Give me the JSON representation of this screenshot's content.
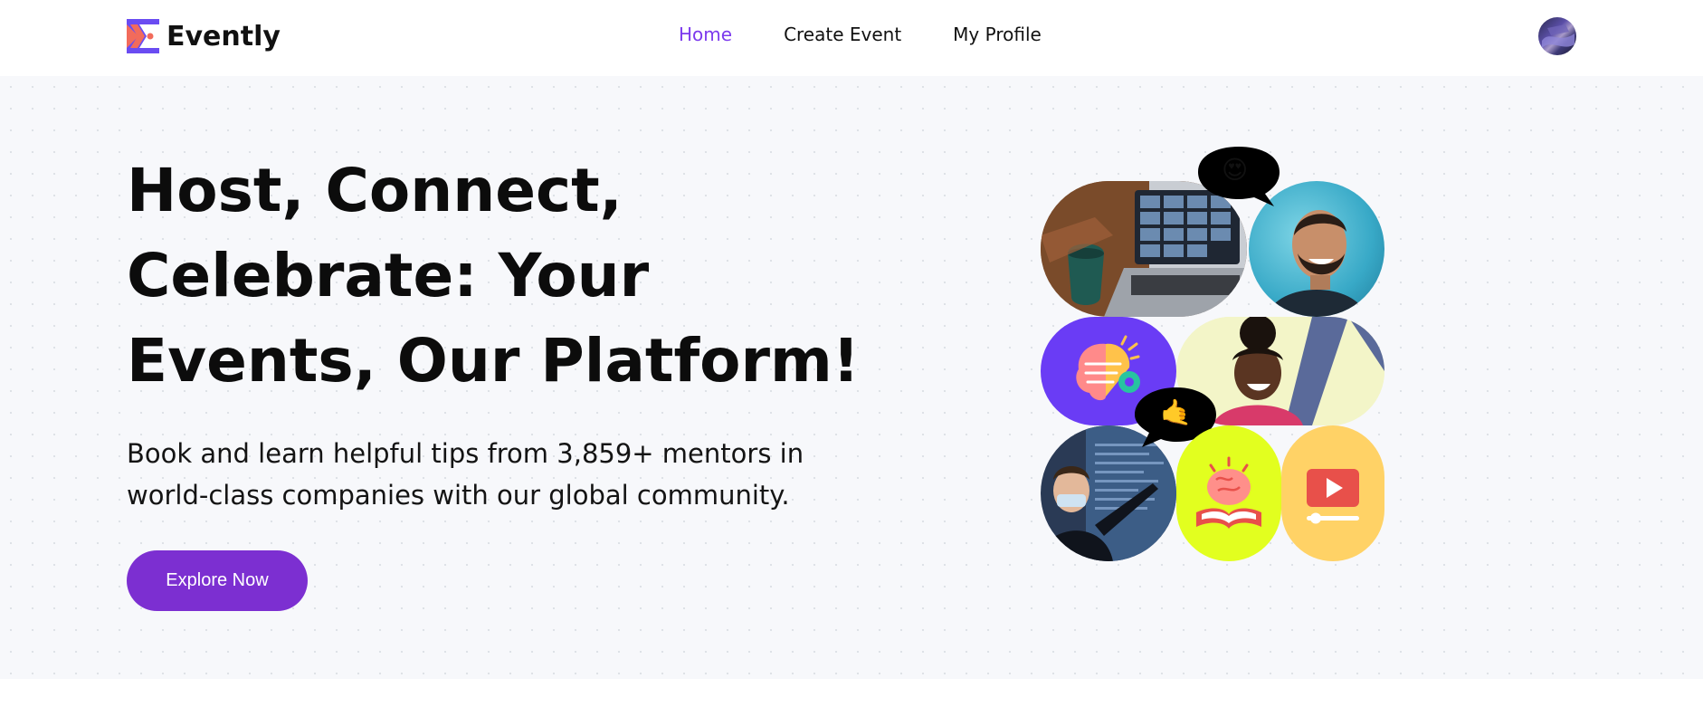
{
  "brand": {
    "name": "Evently",
    "colors": {
      "accent": "#7c3aed",
      "cta": "#7c2fd1",
      "logo_red": "#f26b5b",
      "logo_purple": "#6a4cf2"
    }
  },
  "nav": {
    "items": [
      {
        "label": "Home",
        "active": true
      },
      {
        "label": "Create Event",
        "active": false
      },
      {
        "label": "My Profile",
        "active": false
      }
    ]
  },
  "hero": {
    "title_lines": [
      "Host, Connect,",
      "Celebrate: Your",
      "Events, Our Platform!"
    ],
    "subtitle_lines": [
      "Book and learn helpful tips from 3,859+ mentors in",
      "world-class companies with our global community."
    ],
    "cta_label": "Explore Now"
  },
  "collage": {
    "bubble_top": "😍",
    "bubble_mid": "🤙",
    "tiles": [
      "laptop-video-call-photo",
      "smiling-man-photo",
      "brain-gear-icon",
      "laughing-woman-photo",
      "presenter-photo",
      "brain-book-icon",
      "video-play-icon"
    ]
  }
}
